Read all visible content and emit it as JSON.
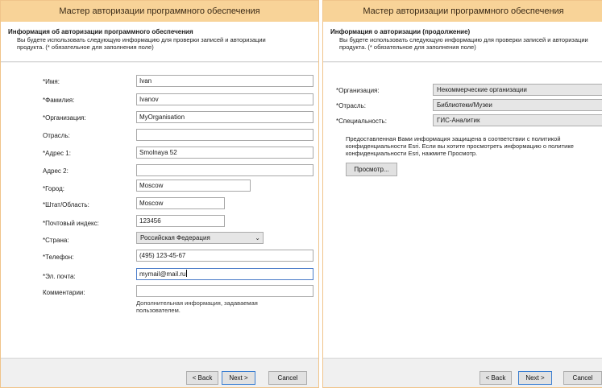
{
  "left": {
    "title": "Мастер авторизации программного обеспечения",
    "header_title": "Информация об авторизации программного обеспечения",
    "header_desc": "Вы будете использовать следующую информацию для проверки записей и авторизации продукта. (* обязательное для заполнения поле)",
    "labels": {
      "name": "*Имя:",
      "surname": "*Фамилия:",
      "org": "*Организация:",
      "industry": "Отрасль:",
      "address1": "*Адрес 1:",
      "address2": "Адрес 2:",
      "city": "*Город:",
      "state": "*Штат/Область:",
      "zip": "*Почтовый индекс:",
      "country": "*Страна:",
      "phone": "*Телефон:",
      "email": "*Эл. почта:",
      "comments": "Комментарии:"
    },
    "values": {
      "name": "Ivan",
      "surname": "Ivanov",
      "org": "MyOrganisation",
      "industry": "",
      "address1": "Smolnaya 52",
      "address2": "",
      "city": "Moscow",
      "state": "Moscow",
      "zip": "123456",
      "country": "Российская Федерация",
      "phone": "(495)  123-45-67",
      "email": "mymail@mail.ru",
      "comments": ""
    },
    "hint": "Дополнительная информация, задаваемая пользователем.",
    "buttons": {
      "back": "< Back",
      "next": "Next >",
      "cancel": "Cancel"
    }
  },
  "right": {
    "title": "Мастер авторизации программного обеспечения",
    "header_title": "Информация о авторизации (продолжение)",
    "header_desc": "Вы будете использовать следующую информацию для проверки записей и авторизации продукта. (* обязательное для заполнения поле)",
    "labels": {
      "org": "*Организация:",
      "industry": "*Отрасль:",
      "specialty": "*Специальность:"
    },
    "values": {
      "org": "Некоммерческие организации",
      "industry": "Библиотеки/Музеи",
      "specialty": "ГИС-Аналитик"
    },
    "privacy": "Предоставленная Вами информация защищена в соответствии с политикой конфиденциальности Esri. Если вы хотите просмотреть информацию о политике конфиденциальности Esri, нажмите Просмотр.",
    "view_button": "Просмотр...",
    "buttons": {
      "back": "< Back",
      "next": "Next >",
      "cancel": "Cancel"
    }
  },
  "icons": {
    "dropdown": "chevron-down-icon"
  }
}
